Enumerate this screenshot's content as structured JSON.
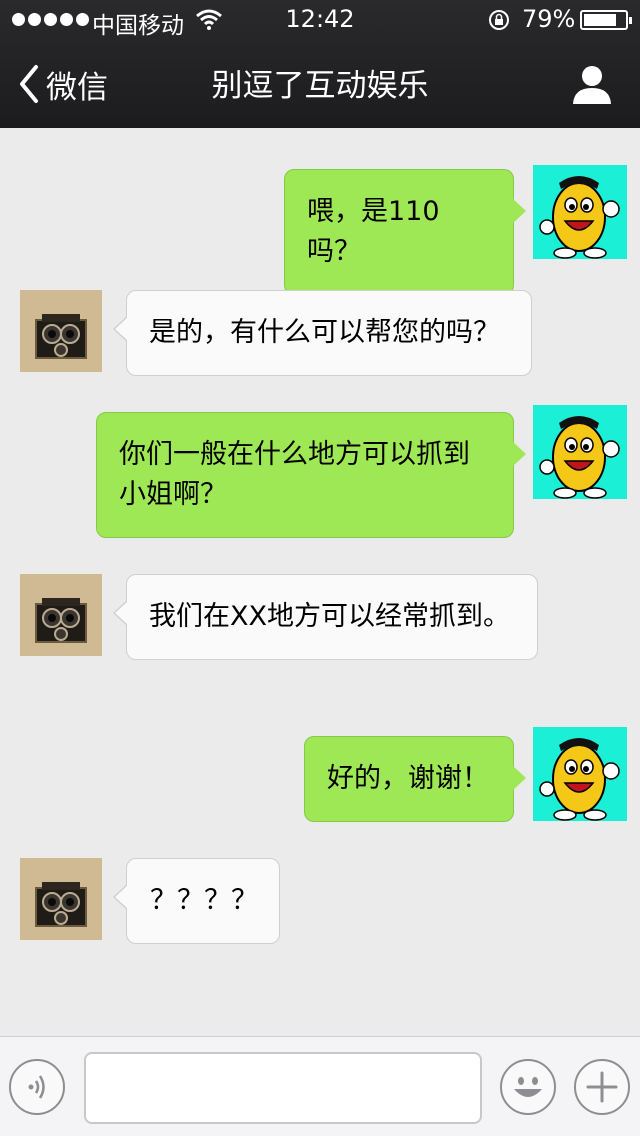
{
  "status_bar": {
    "carrier": "中国移动",
    "time": "12:42",
    "battery_percent": "79%",
    "battery_level": 0.79,
    "signal_dots": 5,
    "icons": [
      "signal-dots-icon",
      "wifi-icon",
      "rotation-lock-icon",
      "battery-icon"
    ]
  },
  "nav": {
    "back_label": "微信",
    "title": "别逗了互动娱乐",
    "icons": [
      "chevron-left-icon",
      "profile-icon"
    ]
  },
  "messages": [
    {
      "sender": "me",
      "text": "喂，是110吗？"
    },
    {
      "sender": "other",
      "text": "是的，有什么可以帮您的吗？"
    },
    {
      "sender": "me",
      "text": "你们一般在什么地方可以抓到小姐啊？"
    },
    {
      "sender": "other",
      "text": "我们在XX地方可以经常抓到。"
    },
    {
      "sender": "me",
      "text": "好的，谢谢！"
    },
    {
      "sender": "other",
      "text": "？？？？"
    }
  ],
  "input_bar": {
    "placeholder": "",
    "icons": [
      "voice-icon",
      "emoji-icon",
      "plus-icon"
    ]
  },
  "colors": {
    "header_bg": "#1c1c1e",
    "chat_bg": "#ebebeb",
    "my_bubble": "#9ee855",
    "other_bubble": "#fafafa",
    "my_avatar_bg": "#1bf0d6"
  }
}
